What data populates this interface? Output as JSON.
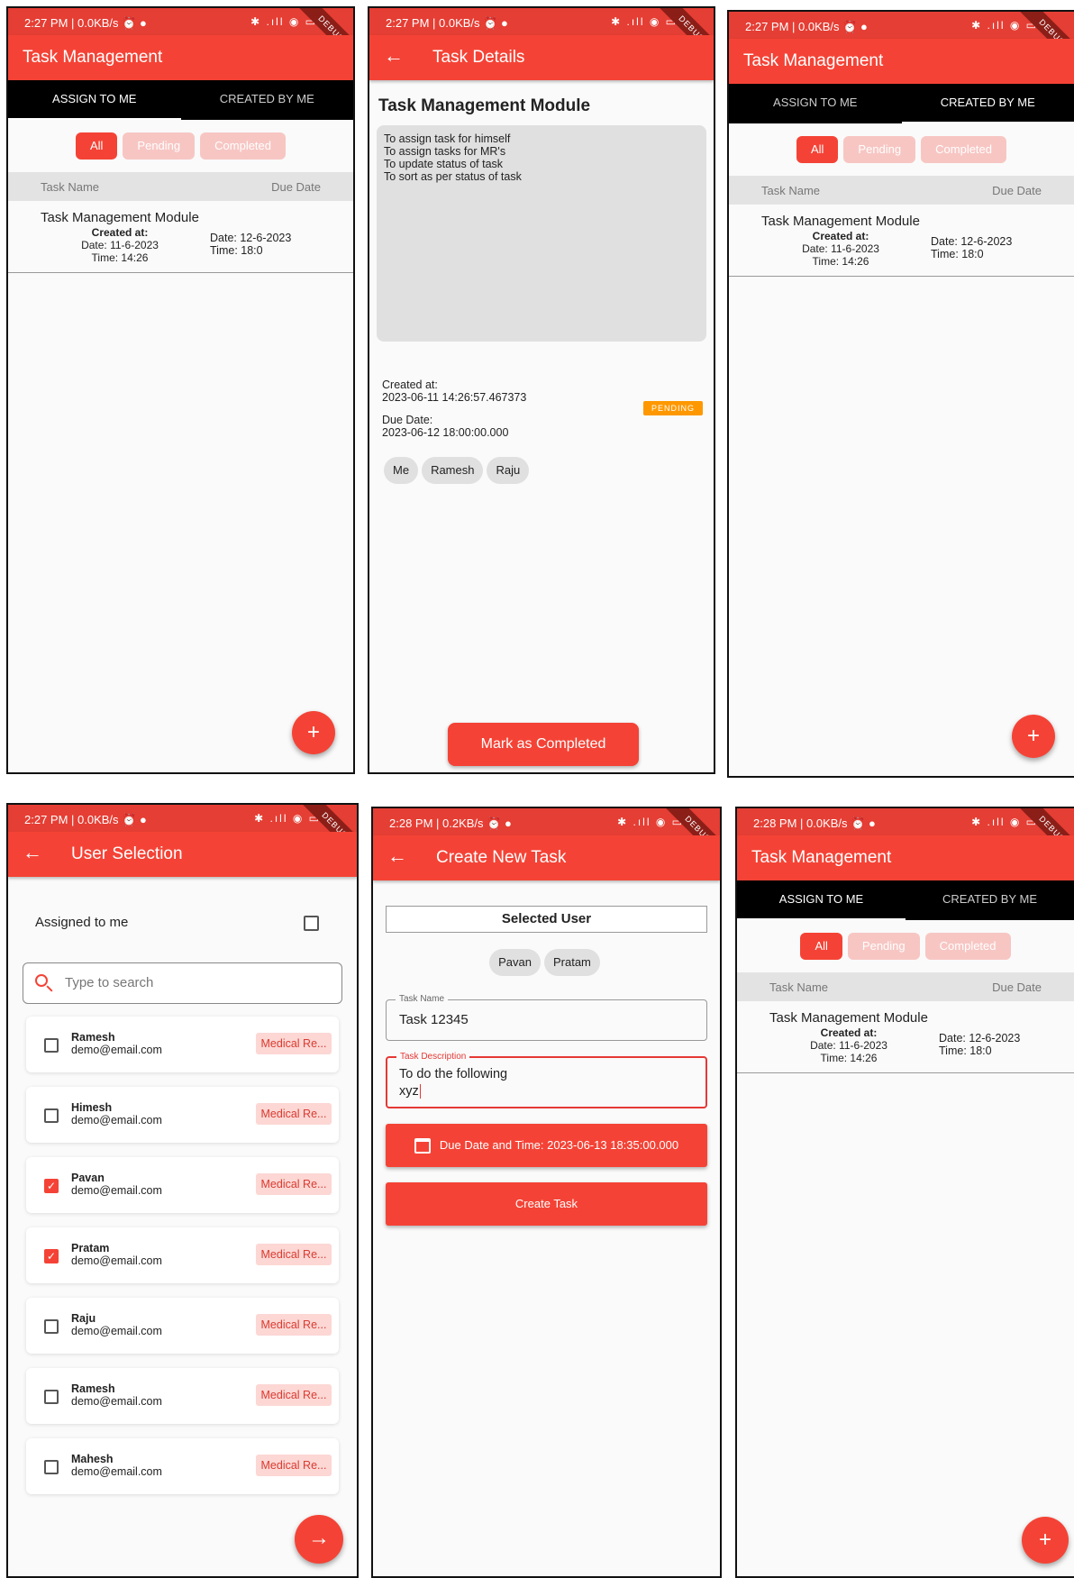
{
  "status_bars": [
    "2:27 PM | 0.0KB/s ⏰ ●",
    "2:27 PM | 0.0KB/s ⏰ ●",
    "2:27 PM | 0.0KB/s ⏰ ●",
    "2:27 PM | 0.0KB/s ⏰ ●",
    "2:28 PM | 0.2KB/s ⏰ ●",
    "2:28 PM | 0.0KB/s ⏰ ●"
  ],
  "status_icons": "✱ .ıll ◉ ▭",
  "debug": "DEBUG",
  "list_screen": {
    "title": "Task Management",
    "tab_assign": "ASSIGN TO ME",
    "tab_created": "CREATED BY ME",
    "chips": [
      "All",
      "Pending",
      "Completed"
    ],
    "col_name": "Task Name",
    "col_due": "Due Date",
    "task": {
      "name": "Task Management Module",
      "created_label": "Created at:",
      "created_date": "Date: 11-6-2023",
      "created_time": "Time: 14:26",
      "due_date": "Date: 12-6-2023",
      "due_time": "Time: 18:0"
    },
    "fab": "+"
  },
  "detail": {
    "title": "Task Details",
    "task_title": "Task Management Module",
    "desc_lines": [
      "To assign task for himself",
      "To assign tasks for MR's",
      "To update status of task",
      "To sort as per status of task"
    ],
    "created_label": "Created at:",
    "created_value": "2023-06-11 14:26:57.467373",
    "due_label": "Due Date:",
    "due_value": "2023-06-12 18:00:00.000",
    "status": "PENDING",
    "users": [
      "Me",
      "Ramesh",
      "Raju"
    ],
    "mark_btn": "Mark as Completed"
  },
  "user_selection": {
    "title": "User Selection",
    "assigned_label": "Assigned to me",
    "search_placeholder": "Type to search",
    "tag": "Medical Re...",
    "users": [
      {
        "name": "Ramesh",
        "email": "demo@email.com",
        "checked": false
      },
      {
        "name": "Himesh",
        "email": "demo@email.com",
        "checked": false
      },
      {
        "name": "Pavan",
        "email": "demo@email.com",
        "checked": true
      },
      {
        "name": "Pratam",
        "email": "demo@email.com",
        "checked": true
      },
      {
        "name": "Raju",
        "email": "demo@email.com",
        "checked": false
      },
      {
        "name": "Ramesh",
        "email": "demo@email.com",
        "checked": false
      },
      {
        "name": "Mahesh",
        "email": "demo@email.com",
        "checked": false
      }
    ],
    "fab": "→"
  },
  "create_task": {
    "title": "Create New Task",
    "selected_user_label": "Selected User",
    "selected_users": [
      "Pavan",
      "Pratam"
    ],
    "name_label": "Task Name",
    "name_value": "Task 12345",
    "desc_label": "Task Description",
    "desc_line1": "To do the following",
    "desc_line2": "xyz",
    "due_btn": "Due Date and Time: 2023-06-13 18:35:00.000",
    "create_btn": "Create Task"
  },
  "colors": {
    "primary": "#f44336",
    "status_bar": "#e53e34",
    "tab_bg": "#000000",
    "pending": "#ff9800",
    "chip_inactive": "#f7c6c3"
  }
}
